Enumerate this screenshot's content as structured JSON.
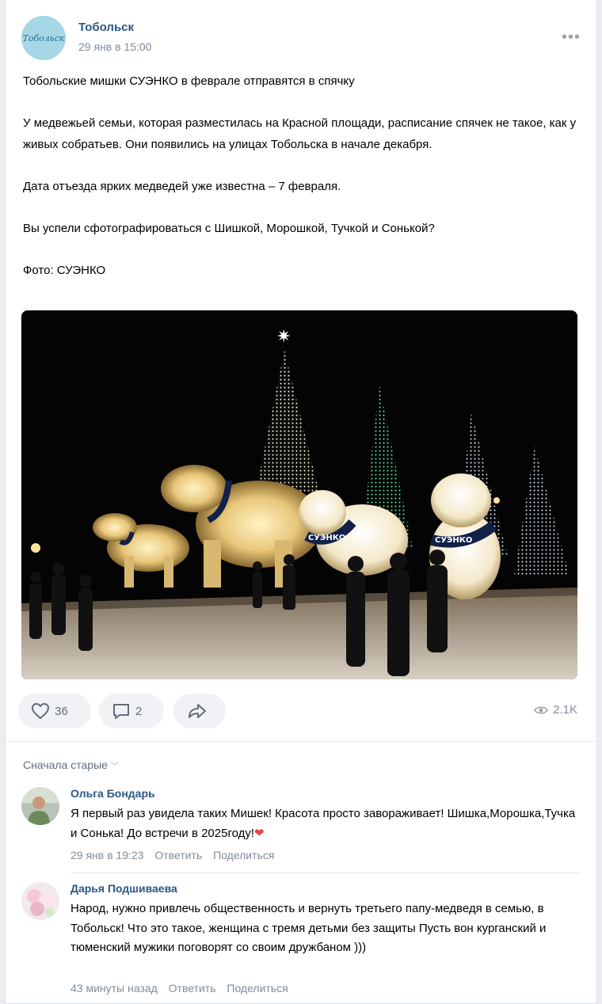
{
  "post": {
    "group_name": "Тобольск",
    "avatar_text": "Тобольск",
    "date": "29 янв в 15:00",
    "more_label": "•••",
    "paragraphs": [
      "Тобольские мишки СУЭНКО в феврале отправятся в спячку",
      "У медвежьей семьи, которая разместилась на Красной площади, расписание спячек не такое, как у живых собратьев. Они появились на улицах Тобольска в начале декабря.",
      "Дата отъезда ярких медведей уже известна – 7 февраля.",
      "Вы успели сфотографироваться с Шишкой, Морошкой, Тучкой и Сонькой?",
      "Фото: СУЭНКО"
    ],
    "photo": {
      "collar_text": "СУЭНКО"
    }
  },
  "actions": {
    "likes": "36",
    "comments": "2",
    "views": "2.1K"
  },
  "comments": {
    "sort_label": "Сначала старые",
    "items": [
      {
        "author": "Ольга Бондарь",
        "text": "Я первый раз увидела таких Мишек! Красота просто завораживает! Шишка,Морошка,Тучка и Сонька! До встречи в 2025году!",
        "time": "29 янв в 19:23",
        "reply": "Ответить",
        "share": "Поделиться"
      },
      {
        "author": "Дарья Подшиваева",
        "text": "Народ, нужно привлечь общественность и вернуть третьего папу-медведя в семью, в Тобольск! Что это такое, женщина с тремя детьми без защиты Пусть вон курганский и тюменский мужики поговорят со своим дружбаном )))",
        "time": "43 минуты назад",
        "reply": "Ответить",
        "share": "Поделиться"
      }
    ]
  },
  "colors": {
    "link": "#2a5885",
    "secondary": "#818c99",
    "pill_bg": "#f0f2f5",
    "heart_emoji": "#e64646"
  }
}
